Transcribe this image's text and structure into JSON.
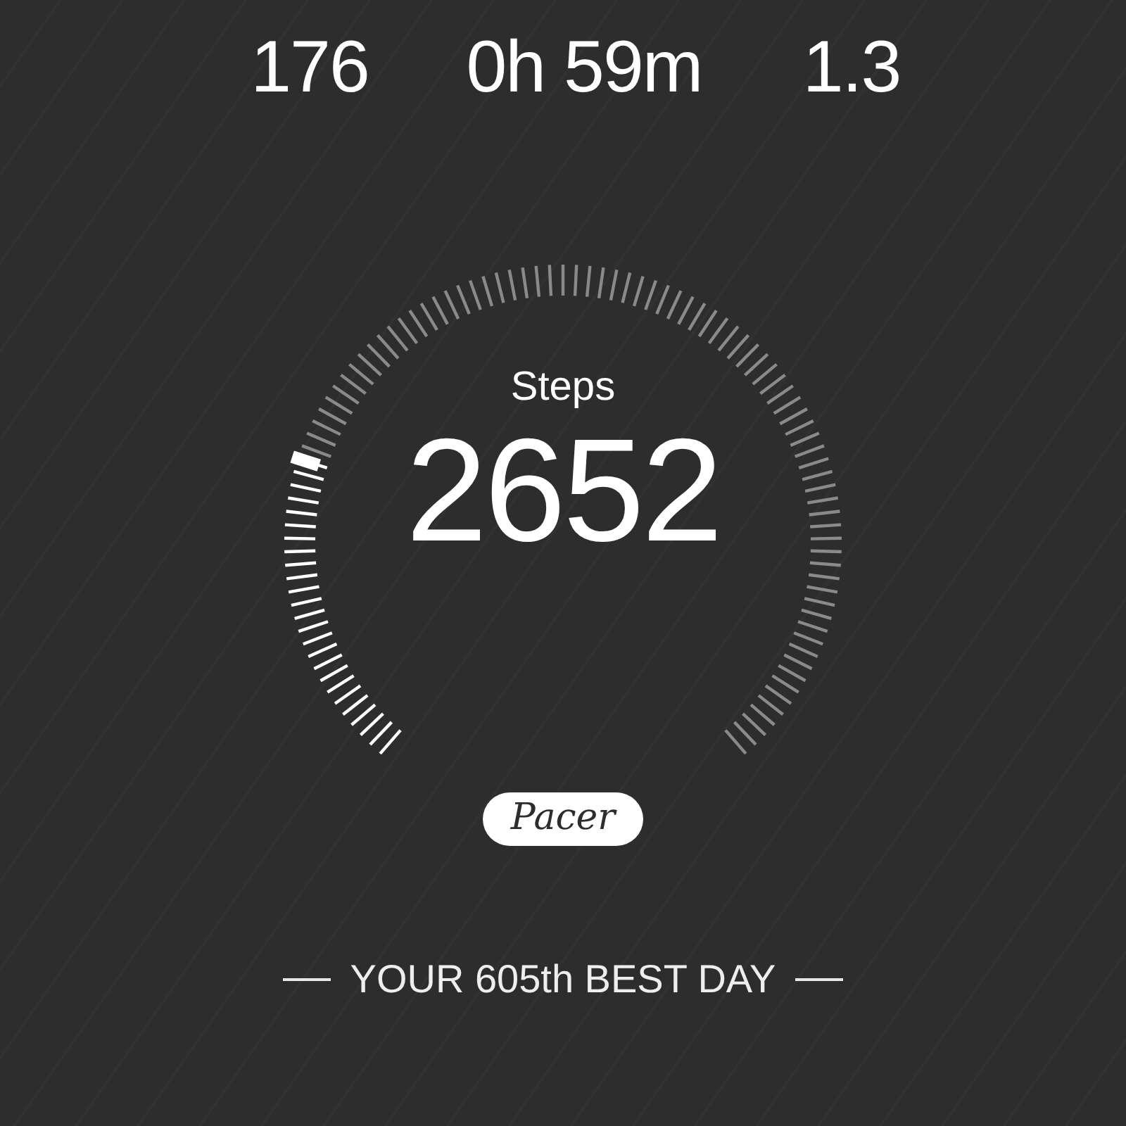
{
  "stats": [
    {
      "value": "176"
    },
    {
      "value": "0h 59m"
    },
    {
      "value": "1.3"
    }
  ],
  "gauge": {
    "label": "Steps",
    "value": "2652"
  },
  "logo": "Pacer",
  "best_day": "YOUR 605th BEST DAY"
}
